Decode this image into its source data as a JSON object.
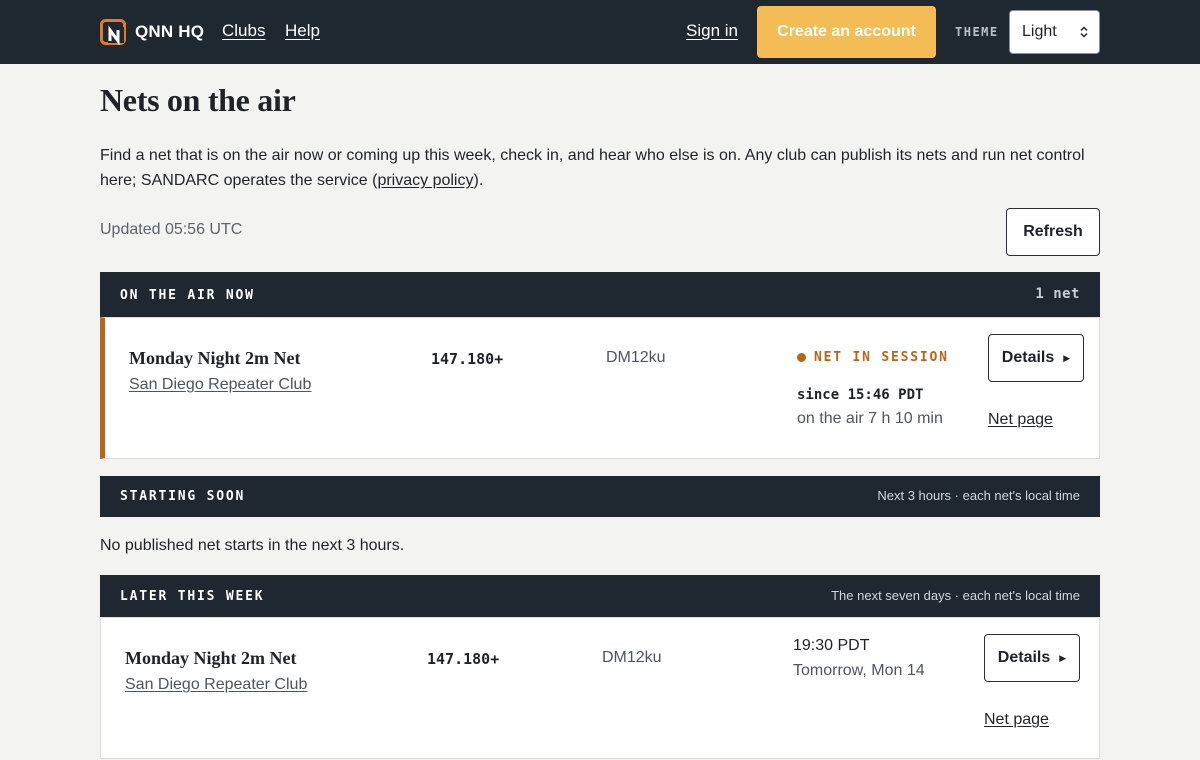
{
  "header": {
    "brand": "QNN HQ",
    "nav": {
      "clubs": "Clubs",
      "help": "Help",
      "sign_in": "Sign in"
    },
    "create_account": "Create an account",
    "theme_label": "THEME",
    "theme_value": "Light"
  },
  "page": {
    "title": "Nets on the air",
    "intro_before": "Find a net that is on the air now or coming up this week, check in, and hear who else is on. Any club can publish its nets and run net control here; SANDARC operates the service (",
    "intro_link": "privacy policy",
    "intro_after": ").",
    "updated": "Updated 05:56 UTC",
    "refresh": "Refresh"
  },
  "on_air": {
    "title": "ON THE AIR NOW",
    "count": "1 net",
    "nets": [
      {
        "name": "Monday Night 2m Net",
        "club": "San Diego Repeater Club",
        "frequency": "147.180+",
        "grid": "DM12ku",
        "status": "NET IN SESSION",
        "since": "since 15:46 PDT",
        "duration": "on the air 7 h 10 min",
        "details": "Details",
        "net_page": "Net page"
      }
    ]
  },
  "starting_soon": {
    "title": "STARTING SOON",
    "meta": "Next 3 hours · each net's local time",
    "empty": "No published net starts in the next 3 hours."
  },
  "later": {
    "title": "LATER THIS WEEK",
    "meta": "The next seven days · each net's local time",
    "nets": [
      {
        "name": "Monday Night 2m Net",
        "club": "San Diego Repeater Club",
        "frequency": "147.180+",
        "grid": "DM12ku",
        "time": "19:30 PDT",
        "day": "Tomorrow, Mon 14",
        "details": "Details",
        "net_page": "Net page"
      }
    ]
  },
  "colors": {
    "header_bg": "#1f2731",
    "accent_yellow": "#f4bc55",
    "live_orange": "#b8651a",
    "page_bg": "#f3f3f1"
  },
  "icons": {
    "logo": "qnn-logo-icon",
    "status_dot": "live-dot-icon",
    "details_arrow": "triangle-right-icon",
    "select_chevron": "chevron-updown-icon"
  }
}
